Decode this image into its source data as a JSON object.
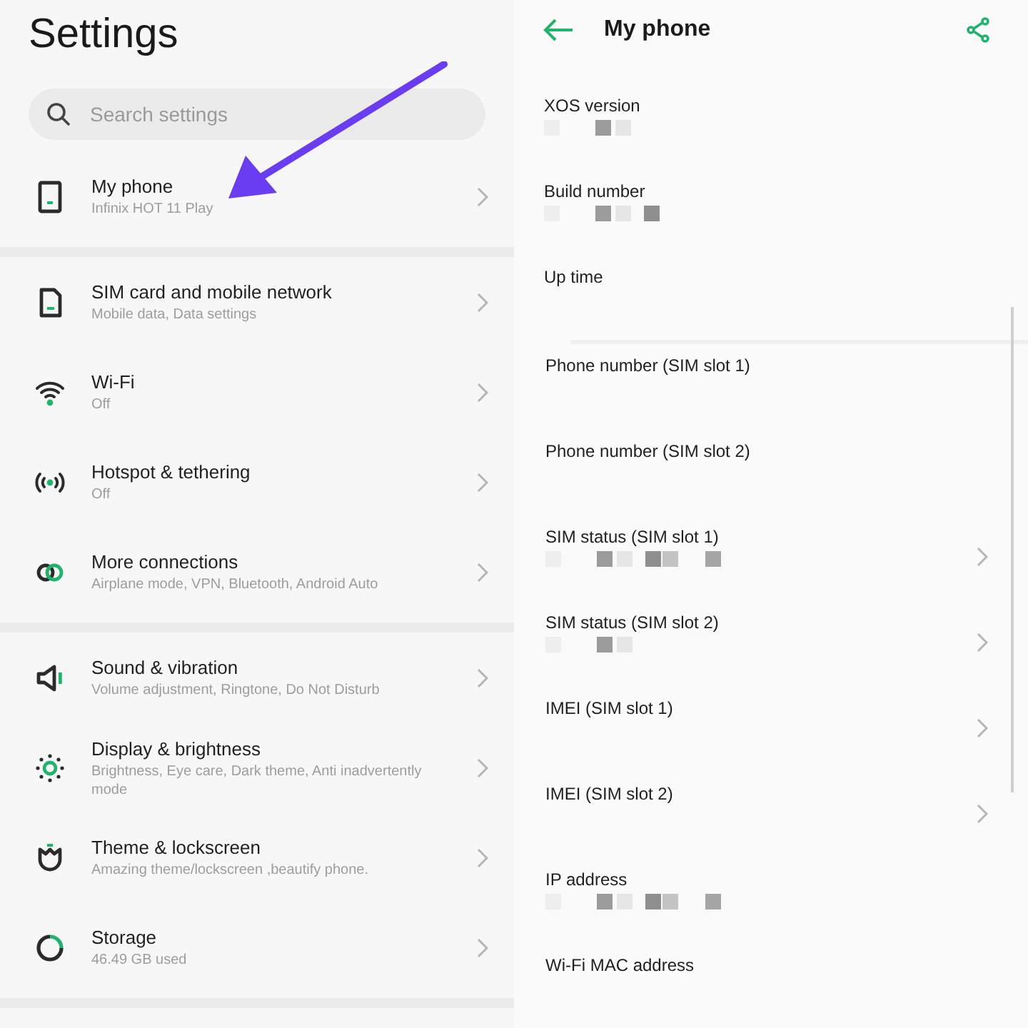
{
  "settings": {
    "title": "Settings",
    "search": {
      "placeholder": "Search settings"
    },
    "groups": [
      [
        {
          "title": "My phone",
          "subtitle": "Infinix HOT 11 Play"
        }
      ],
      [
        {
          "title": "SIM card and mobile network",
          "subtitle": "Mobile data, Data settings"
        },
        {
          "title": "Wi-Fi",
          "subtitle": "Off"
        },
        {
          "title": "Hotspot & tethering",
          "subtitle": "Off"
        },
        {
          "title": "More connections",
          "subtitle": "Airplane mode, VPN, Bluetooth, Android Auto"
        }
      ],
      [
        {
          "title": "Sound & vibration",
          "subtitle": "Volume adjustment, Ringtone, Do Not Disturb"
        },
        {
          "title": "Display & brightness",
          "subtitle": "Brightness, Eye care, Dark theme, Anti inadvertently mode"
        },
        {
          "title": "Theme & lockscreen",
          "subtitle": "Amazing theme/lockscreen ,beautify phone."
        },
        {
          "title": "Storage",
          "subtitle": "46.49 GB used"
        }
      ]
    ]
  },
  "my_phone": {
    "title": "My phone",
    "groups": [
      [
        {
          "label": "XOS version",
          "redacted": true,
          "chevron": false
        },
        {
          "label": "Build number",
          "redacted": true,
          "chevron": false
        },
        {
          "label": "Up time",
          "redacted": false,
          "chevron": false
        }
      ],
      [
        {
          "label": "Phone number (SIM slot 1)",
          "redacted": false,
          "chevron": false
        },
        {
          "label": "Phone number (SIM slot 2)",
          "redacted": false,
          "chevron": false
        },
        {
          "label": "SIM status (SIM slot 1)",
          "redacted": true,
          "chevron": true
        },
        {
          "label": "SIM status (SIM slot 2)",
          "redacted": true,
          "chevron": true
        },
        {
          "label": "IMEI (SIM slot 1)",
          "redacted": false,
          "chevron": true
        },
        {
          "label": "IMEI (SIM slot 2)",
          "redacted": false,
          "chevron": true
        },
        {
          "label": "IP address",
          "redacted": true,
          "chevron": false
        },
        {
          "label": "Wi-Fi MAC address",
          "redacted": false,
          "chevron": false
        }
      ]
    ]
  }
}
